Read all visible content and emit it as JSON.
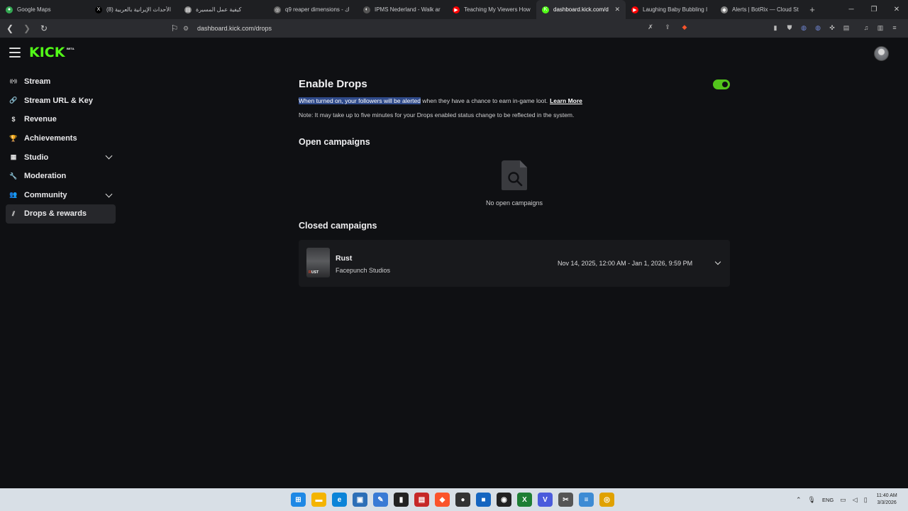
{
  "browser": {
    "tabs": [
      {
        "label": "Google Maps",
        "icon": "map-pin-icon",
        "color": "#34a853"
      },
      {
        "label": "(8) الأحداث الإيرانية بالعربية",
        "icon": "x-icon",
        "color": "#000000"
      },
      {
        "label": "كيفية عمل المسيرة",
        "icon": "page-icon",
        "color": "#888888"
      },
      {
        "label": "q9 reaper dimensions - ك",
        "icon": "search-icon",
        "color": "#666666"
      },
      {
        "label": "IPMS Nederland - Walk ar",
        "icon": "site-icon",
        "color": "#555555"
      },
      {
        "label": "Teaching My Viewers How",
        "icon": "youtube-icon",
        "color": "#ff0000"
      },
      {
        "label": "dashboard.kick.com/d",
        "icon": "kick-icon",
        "color": "#53fc18"
      },
      {
        "label": "Laughing Baby Bubbling I",
        "icon": "youtube-icon",
        "color": "#ff0000"
      },
      {
        "label": "Alerts | BotRix — Cloud St",
        "icon": "diamond-icon",
        "color": "#888888"
      }
    ],
    "active_tab_index": 6,
    "url": "dashboard.kick.com/drops"
  },
  "app": {
    "logo": "KICK",
    "logo_badge": "BETA",
    "brand_color": "#53fc18"
  },
  "sidebar": {
    "items": [
      {
        "label": "Stream",
        "icon": "broadcast-icon",
        "expandable": false,
        "active": false
      },
      {
        "label": "Stream URL & Key",
        "icon": "link-icon",
        "expandable": false,
        "active": false
      },
      {
        "label": "Revenue",
        "icon": "dollar-icon",
        "expandable": false,
        "active": false
      },
      {
        "label": "Achievements",
        "icon": "trophy-icon",
        "expandable": false,
        "active": false
      },
      {
        "label": "Studio",
        "icon": "studio-icon",
        "expandable": true,
        "active": false
      },
      {
        "label": "Moderation",
        "icon": "wrench-icon",
        "expandable": false,
        "active": false
      },
      {
        "label": "Community",
        "icon": "community-icon",
        "expandable": true,
        "active": false
      },
      {
        "label": "Drops & rewards",
        "icon": "drops-icon",
        "expandable": false,
        "active": true
      }
    ]
  },
  "drops": {
    "title": "Enable Drops",
    "enabled": true,
    "description_selected": "When turned on, your followers will be alerted",
    "description_rest": " when they have a chance to earn in-game loot.",
    "learn_more": "Learn More",
    "note": "Note: It may take up to five minutes for your Drops enabled status change to be reflected in the system."
  },
  "open_campaigns": {
    "title": "Open campaigns",
    "empty_text": "No open campaigns"
  },
  "closed_campaigns": {
    "title": "Closed campaigns",
    "items": [
      {
        "game": "Rust",
        "publisher": "Facepunch Studios",
        "thumb_text": "RUST",
        "dates": "Nov 14, 2025, 12:00 AM - Jan 1, 2026, 9:59 PM"
      }
    ]
  },
  "taskbar": {
    "apps": [
      {
        "name": "windows-start-icon",
        "color": "#1e88e5",
        "glyph": "⊞"
      },
      {
        "name": "file-explorer-icon",
        "color": "#f4b400",
        "glyph": "▬"
      },
      {
        "name": "edge-icon",
        "color": "#0b84d8",
        "glyph": "e"
      },
      {
        "name": "store-icon",
        "color": "#2d6fb7",
        "glyph": "▣"
      },
      {
        "name": "mail-icon",
        "color": "#3a7bd5",
        "glyph": "✎"
      },
      {
        "name": "terminal-icon",
        "color": "#222222",
        "glyph": "▮"
      },
      {
        "name": "streamer-app-icon",
        "color": "#c62828",
        "glyph": "▤"
      },
      {
        "name": "brave-icon",
        "color": "#fb542b",
        "glyph": "◆"
      },
      {
        "name": "obs-icon",
        "color": "#333333",
        "glyph": "●"
      },
      {
        "name": "app-icon",
        "color": "#1565c0",
        "glyph": "■"
      },
      {
        "name": "circle-app-icon",
        "color": "#222222",
        "glyph": "◉"
      },
      {
        "name": "excel-icon",
        "color": "#1e7e34",
        "glyph": "X"
      },
      {
        "name": "vscode-icon",
        "color": "#4a5bdc",
        "glyph": "V"
      },
      {
        "name": "tool-icon",
        "color": "#555555",
        "glyph": "✂"
      },
      {
        "name": "notepad-icon",
        "color": "#3d8bd4",
        "glyph": "≡"
      },
      {
        "name": "chrome-icon",
        "color": "#e0a100",
        "glyph": "◎"
      }
    ],
    "language": "ENG",
    "time": "11:40 AM",
    "date": "3/3/2026"
  }
}
